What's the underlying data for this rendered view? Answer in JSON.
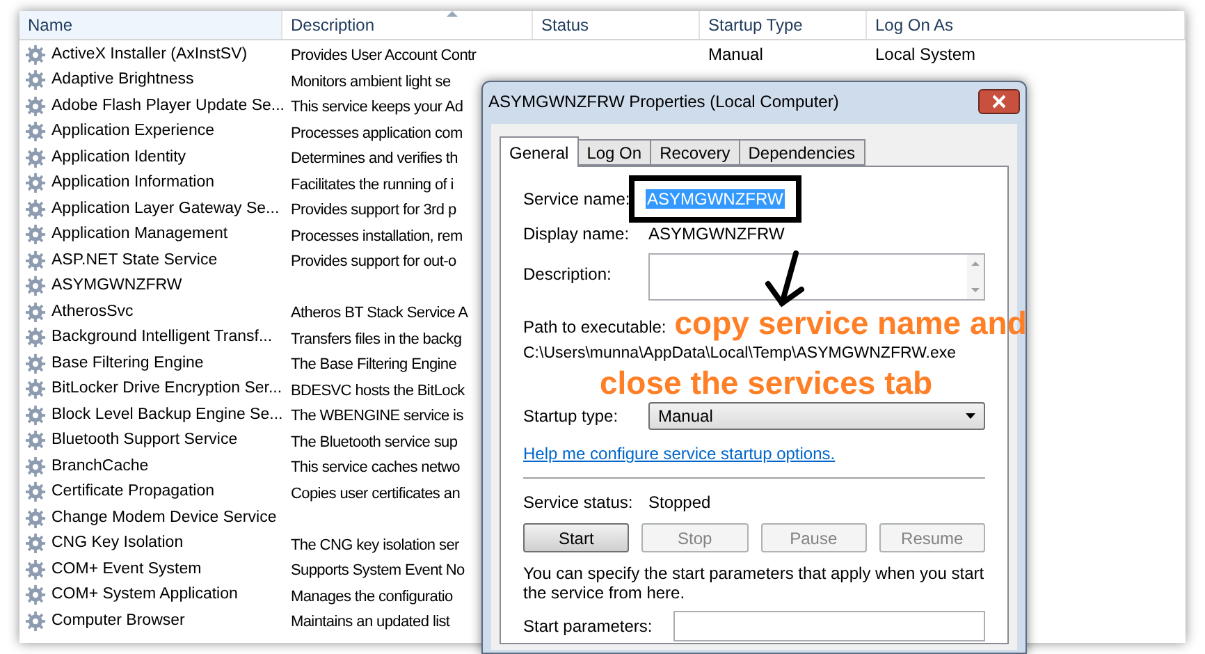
{
  "services": {
    "columns": [
      "Name",
      "Description",
      "Status",
      "Startup Type",
      "Log On As"
    ],
    "rows": [
      {
        "name": "ActiveX Installer (AxInstSV)",
        "description": "Provides User Account Contr",
        "startup_type": "Manual",
        "log_on_as": "Local System"
      },
      {
        "name": "Adaptive Brightness",
        "description": "Monitors ambient light se"
      },
      {
        "name": "Adobe Flash Player Update Se...",
        "description": "This service keeps your Ad"
      },
      {
        "name": "Application Experience",
        "description": "Processes application com"
      },
      {
        "name": "Application Identity",
        "description": "Determines and verifies th"
      },
      {
        "name": "Application Information",
        "description": "Facilitates the running of i"
      },
      {
        "name": "Application Layer Gateway Se...",
        "description": "Provides support for 3rd p"
      },
      {
        "name": "Application Management",
        "description": "Processes installation, rem"
      },
      {
        "name": "ASP.NET State Service",
        "description": "Provides support for out-o"
      },
      {
        "name": "ASYMGWNZFRW"
      },
      {
        "name": "AtherosSvc",
        "description": "Atheros BT Stack Service A"
      },
      {
        "name": "Background Intelligent Transf...",
        "description": "Transfers files in the backg"
      },
      {
        "name": "Base Filtering Engine",
        "description": "The Base Filtering Engine"
      },
      {
        "name": "BitLocker Drive Encryption Ser...",
        "description": "BDESVC hosts the BitLock"
      },
      {
        "name": "Block Level Backup Engine Se...",
        "description": "The WBENGINE service is"
      },
      {
        "name": "Bluetooth Support Service",
        "description": "The Bluetooth service sup"
      },
      {
        "name": "BranchCache",
        "description": "This service caches netwo"
      },
      {
        "name": "Certificate Propagation",
        "description": "Copies user certificates an"
      },
      {
        "name": "Change Modem Device Service"
      },
      {
        "name": "CNG Key Isolation",
        "description": "The CNG key isolation ser"
      },
      {
        "name": "COM+ Event System",
        "description": "Supports System Event No"
      },
      {
        "name": "COM+ System Application",
        "description": "Manages the configuratio"
      },
      {
        "name": "Computer Browser",
        "description": "Maintains an updated list"
      }
    ]
  },
  "dialog": {
    "title": "ASYMGWNZFRW Properties (Local Computer)",
    "tabs": [
      {
        "label": "General",
        "selected": true
      },
      {
        "label": "Log On",
        "selected": false
      },
      {
        "label": "Recovery",
        "selected": false
      },
      {
        "label": "Dependencies",
        "selected": false
      }
    ],
    "service_name_label": "Service name:",
    "service_name": "ASYMGWNZFRW",
    "display_name_label": "Display name:",
    "display_name": "ASYMGWNZFRW",
    "description_label": "Description:",
    "path_label": "Path to executable:",
    "path": "C:\\Users\\munna\\AppData\\Local\\Temp\\ASYMGWNZFRW.exe",
    "startup_type_label": "Startup type:",
    "startup_type": "Manual",
    "help_link": "Help me configure service startup options.",
    "status_label": "Service status:",
    "status": "Stopped",
    "buttons": [
      {
        "label": "Start",
        "disabled": false
      },
      {
        "label": "Stop",
        "disabled": true
      },
      {
        "label": "Pause",
        "disabled": true
      },
      {
        "label": "Resume",
        "disabled": true
      }
    ],
    "note": "You can specify the start parameters that apply when you start the service from here.",
    "start_parameters_label": "Start parameters:"
  },
  "annotation": {
    "lines": [
      "copy service name and",
      "close the services tab"
    ]
  }
}
